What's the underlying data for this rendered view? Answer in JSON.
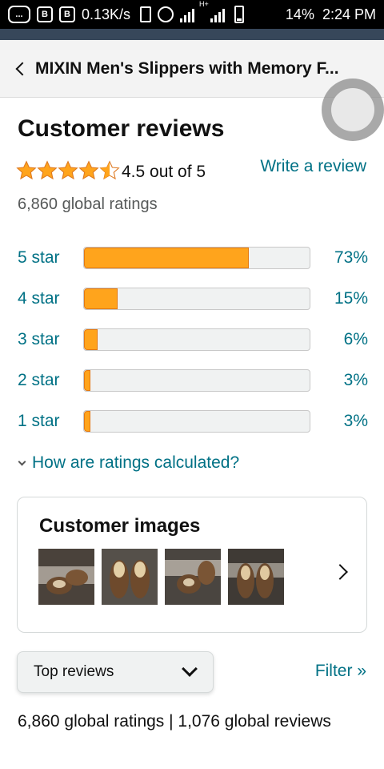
{
  "status_bar": {
    "chat_icon_text": "...",
    "coin_icon_text": "B",
    "speed": "0.13K/s",
    "network": "H+",
    "battery": "14%",
    "time": "2:24 PM"
  },
  "header": {
    "title": "MIXIN Men's Slippers with Memory F..."
  },
  "reviews": {
    "heading": "Customer reviews",
    "rating": 4.5,
    "rating_text": "4.5 out of 5",
    "write_review": "Write a review",
    "global_ratings": "6,860 global ratings",
    "star_color": "#ffa41c",
    "histogram": [
      {
        "label": "5 star",
        "percent": 73,
        "percent_text": "73%"
      },
      {
        "label": "4 star",
        "percent": 15,
        "percent_text": "15%"
      },
      {
        "label": "3 star",
        "percent": 6,
        "percent_text": "6%"
      },
      {
        "label": "2 star",
        "percent": 3,
        "percent_text": "3%"
      },
      {
        "label": "1 star",
        "percent": 3,
        "percent_text": "3%"
      }
    ],
    "how_calculated": "How are ratings calculated?"
  },
  "customer_images": {
    "title": "Customer images",
    "thumbnails": [
      "slipper-photo-1",
      "slipper-photo-2",
      "slipper-photo-3",
      "slipper-photo-4"
    ]
  },
  "controls": {
    "sort_selected": "Top reviews",
    "filter": "Filter »"
  },
  "summary": "6,860 global ratings | 1,076 global reviews",
  "colors": {
    "link": "#007185",
    "bar_fill": "#ffa41c",
    "bar_bg": "#f0f2f2",
    "header_accent": "#37475a"
  }
}
